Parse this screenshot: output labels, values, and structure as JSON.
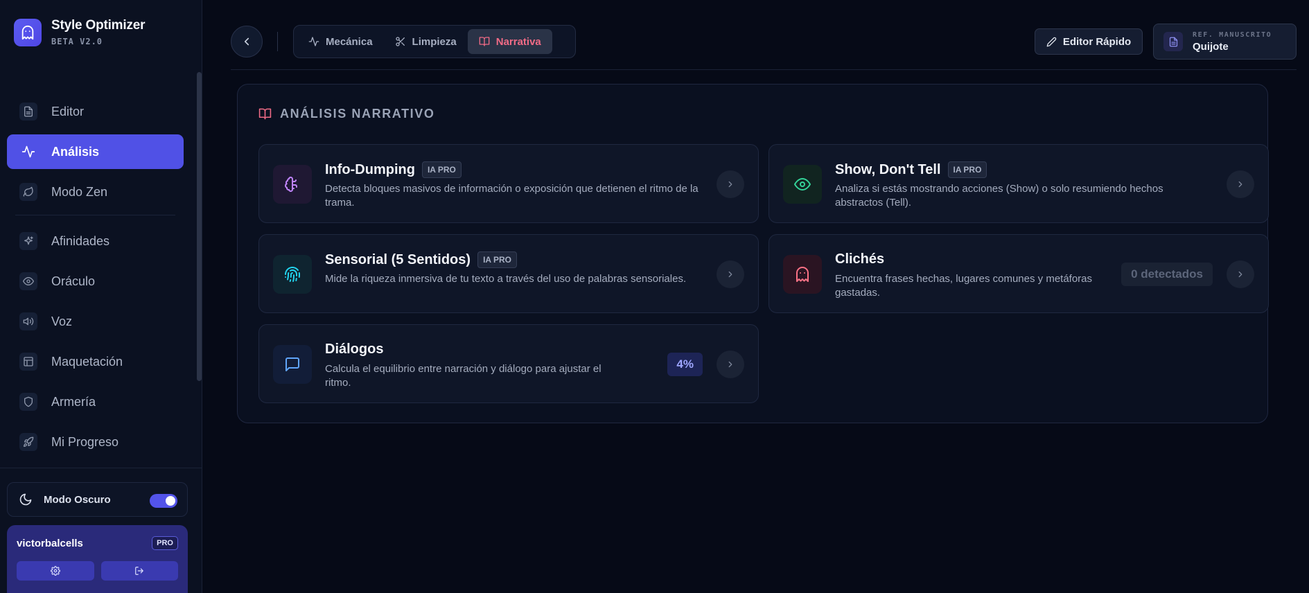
{
  "brand": {
    "title": "Style Optimizer",
    "subtitle": "BETA V2.0",
    "logo_icon": "ghost-icon",
    "accent": "#5051e6"
  },
  "sidebar": {
    "items": [
      {
        "label": "Editor",
        "icon": "document-icon",
        "active": false
      },
      {
        "label": "Análisis",
        "icon": "activity-icon",
        "active": true
      },
      {
        "label": "Modo Zen",
        "icon": "leaf-icon",
        "active": false
      },
      {
        "label": "Afinidades",
        "icon": "sparkles-icon",
        "active": false
      },
      {
        "label": "Oráculo",
        "icon": "eye-icon",
        "active": false
      },
      {
        "label": "Voz",
        "icon": "speaker-icon",
        "active": false
      },
      {
        "label": "Maquetación",
        "icon": "layout-icon",
        "active": false
      },
      {
        "label": "Armería",
        "icon": "shield-icon",
        "active": false
      },
      {
        "label": "Mi Progreso",
        "icon": "rocket-icon",
        "active": false
      }
    ],
    "dark_mode": {
      "label": "Modo Oscuro",
      "enabled": true
    },
    "user": {
      "name": "victorbalcells",
      "plan": "PRO"
    }
  },
  "header": {
    "tabs": [
      {
        "label": "Mecánica",
        "icon": "activity-icon",
        "active": false
      },
      {
        "label": "Limpieza",
        "icon": "scissors-icon",
        "active": false
      },
      {
        "label": "Narrativa",
        "icon": "book-open-icon",
        "active": true
      }
    ],
    "quick_editor_label": "Editor Rápido",
    "manuscript": {
      "label": "REF. MANUSCRITO",
      "value": "Quijote"
    }
  },
  "panel": {
    "title": "ANÁLISIS NARRATIVO",
    "cards": [
      {
        "title": "Info-Dumping",
        "tag": "IA PRO",
        "description": "Detecta bloques masivos de información o exposición que detienen el ritmo de la trama.",
        "icon": "brain-icon"
      },
      {
        "title": "Show, Don't Tell",
        "tag": "IA PRO",
        "description": "Analiza si estás mostrando acciones (Show) o solo resumiendo hechos abstractos (Tell).",
        "icon": "eye-icon"
      },
      {
        "title": "Sensorial (5 Sentidos)",
        "tag": "IA PRO",
        "description": "Mide la riqueza inmersiva de tu texto a través del uso de palabras sensoriales.",
        "icon": "fingerprint-icon"
      },
      {
        "title": "Clichés",
        "description": "Encuentra frases hechas, lugares comunes y metáforas gastadas.",
        "badge": "0 detectados",
        "icon": "ghost-icon"
      },
      {
        "title": "Diálogos",
        "description": "Calcula el equilibrio entre narración y diálogo para ajustar el ritmo.",
        "badge": "4%",
        "icon": "message-square-icon"
      }
    ]
  }
}
